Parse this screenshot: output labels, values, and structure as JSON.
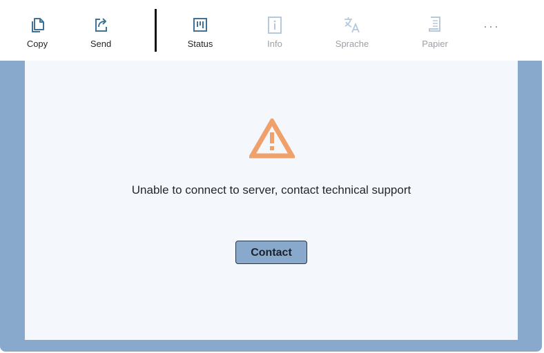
{
  "toolbar": {
    "items": [
      {
        "label": "Copy",
        "icon": "copy-icon",
        "enabled": true
      },
      {
        "label": "Send",
        "icon": "send-icon",
        "enabled": true
      },
      {
        "label": "Status",
        "icon": "status-icon",
        "enabled": true
      },
      {
        "label": "Info",
        "icon": "info-icon",
        "enabled": false
      },
      {
        "label": "Sprache",
        "icon": "language-icon",
        "enabled": false
      },
      {
        "label": "Papier",
        "icon": "paper-icon",
        "enabled": false
      }
    ],
    "more_label": "···"
  },
  "message": {
    "text": "Unable to connect to server, contact technical support",
    "button_label": "Contact"
  },
  "colors": {
    "accent": "#3d7197",
    "warning": "#f0a06a",
    "frame": "#88a8cc",
    "content_bg": "#f4f8fc",
    "disabled": "#b5c9dc"
  }
}
